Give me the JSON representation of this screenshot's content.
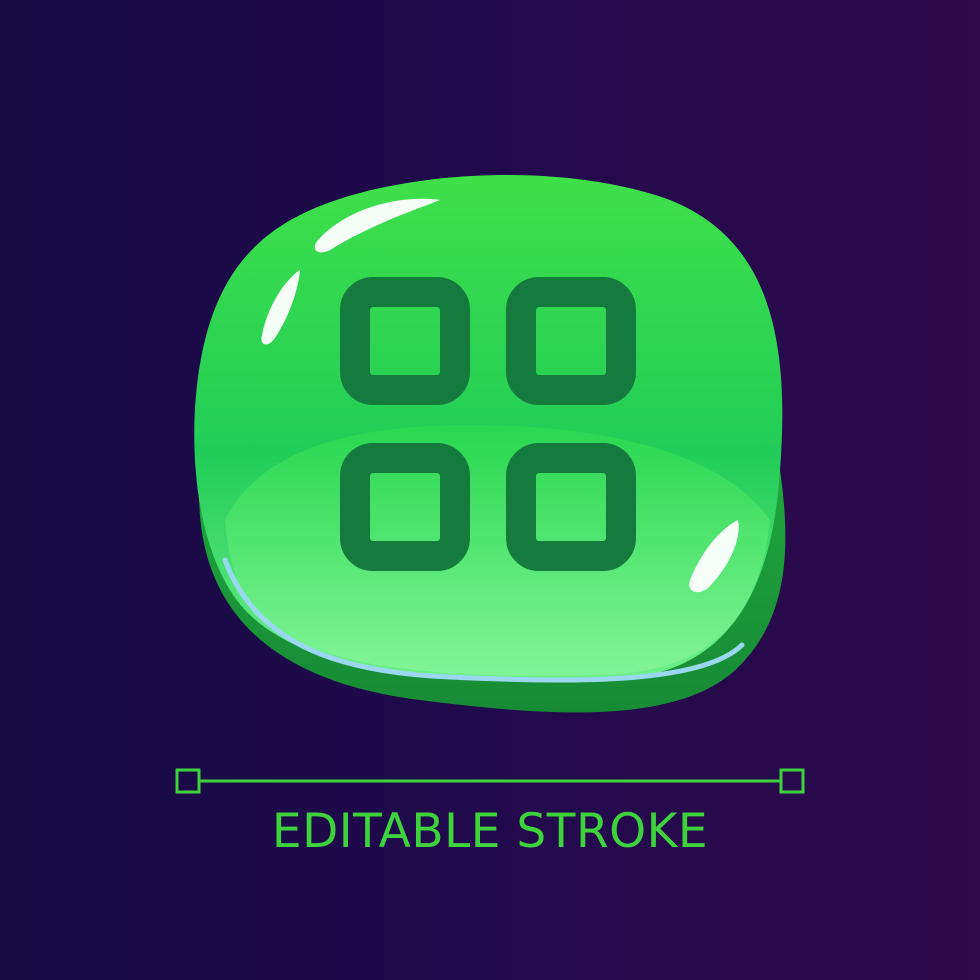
{
  "caption": "EDITABLE STROKE",
  "icon": {
    "name": "grid-four-squares-icon",
    "style": "glossy-green-button"
  },
  "colors": {
    "background_left": "#160a45",
    "background_right": "#2f0a4d",
    "button_green": "#2ed33e",
    "button_side": "#1a9a3a",
    "icon_stroke": "#157a3e",
    "caption_green": "#3ed23c",
    "rim_highlight": "#9ad8f0"
  }
}
